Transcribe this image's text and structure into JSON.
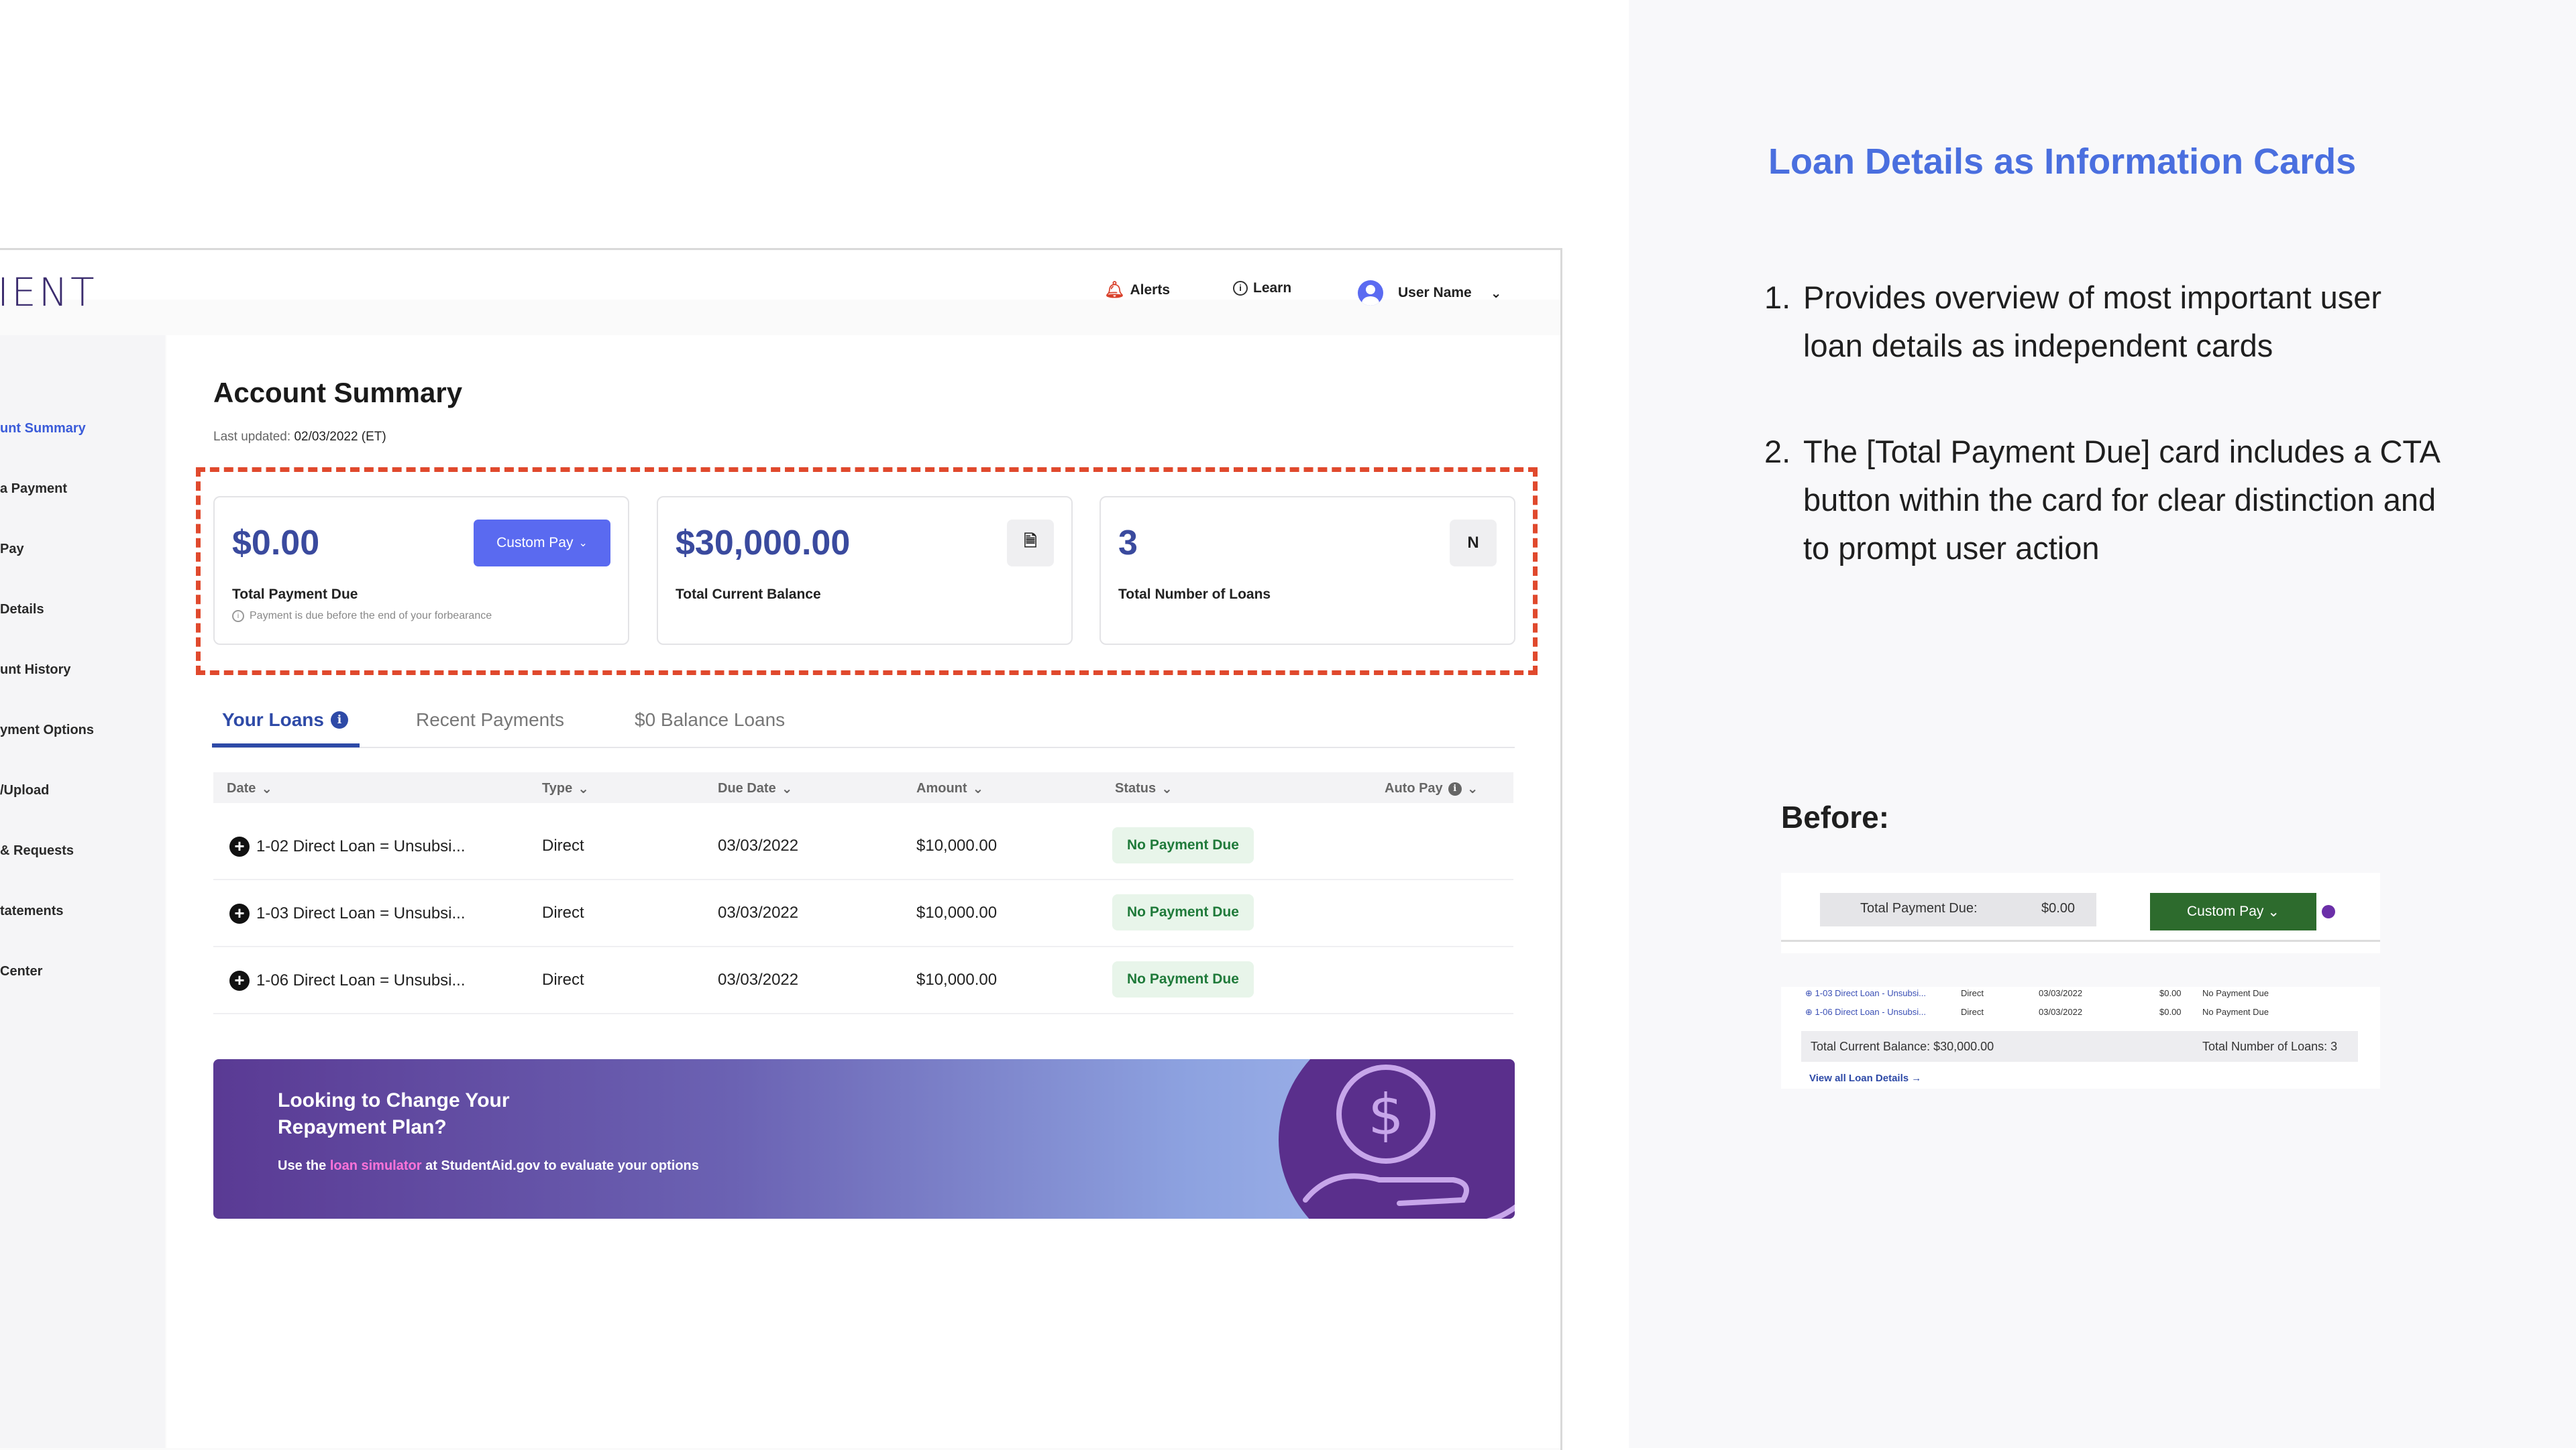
{
  "annotation": {
    "title": "Loan Details as Information Cards",
    "points": [
      {
        "num": "1.",
        "text": "Provides overview of most important user loan details as independent cards"
      },
      {
        "num": "2.",
        "text": "The [Total Payment Due] card includes a CTA button within the card for clear distinction and to prompt user action"
      }
    ],
    "before_label": "Before:",
    "before": {
      "total_payment_label": "Total Payment Due:",
      "total_payment_value": "$0.00",
      "custom_pay": "Custom Pay",
      "rows": [
        {
          "loan": "1-03 Direct Loan - Unsubsi...",
          "type": "Direct",
          "date": "03/03/2022",
          "amount": "$0.00",
          "status": "No Payment Due"
        },
        {
          "loan": "1-06 Direct Loan - Unsubsi...",
          "type": "Direct",
          "date": "03/03/2022",
          "amount": "$0.00",
          "status": "No Payment Due"
        }
      ],
      "total_balance": "Total Current Balance:  $30,000.00",
      "total_loans": "Total Number of Loans:  3",
      "view_all": "View all Loan Details →"
    }
  },
  "app": {
    "logo": "IENT",
    "header": {
      "alerts": "Alerts",
      "learn": "Learn",
      "user": "User Name"
    },
    "sidebar": [
      "unt Summary",
      "a Payment",
      "Pay",
      "Details",
      "unt History",
      "yment Options",
      "/Upload",
      "& Requests",
      "tatements",
      "Center"
    ],
    "page_title": "Account Summary",
    "last_updated_label": "Last updated:",
    "last_updated_value": "02/03/2022 (ET)",
    "cards": {
      "payment": {
        "value": "$0.00",
        "label": "Total Payment Due",
        "button": "Custom Pay",
        "note": "Payment is due before the end of your forbearance"
      },
      "balance": {
        "value": "$30,000.00",
        "label": "Total Current Balance",
        "icon": "🗎"
      },
      "loans": {
        "value": "3",
        "label": "Total Number of Loans",
        "icon": "N"
      }
    },
    "tabs": [
      "Your Loans",
      "Recent Payments",
      "$0 Balance Loans"
    ],
    "table": {
      "headers": [
        "Date",
        "Type",
        "Due Date",
        "Amount",
        "Status",
        "Auto Pay"
      ],
      "rows": [
        {
          "loan": "1-02 Direct Loan = Unsubsi...",
          "type": "Direct",
          "due": "03/03/2022",
          "amount": "$10,000.00",
          "status": "No Payment Due"
        },
        {
          "loan": "1-03 Direct Loan = Unsubsi...",
          "type": "Direct",
          "due": "03/03/2022",
          "amount": "$10,000.00",
          "status": "No Payment Due"
        },
        {
          "loan": "1-06 Direct Loan = Unsubsi...",
          "type": "Direct",
          "due": "03/03/2022",
          "amount": "$10,000.00",
          "status": "No Payment Due"
        }
      ]
    },
    "banner": {
      "title": "Looking to Change Your Repayment Plan?",
      "text_before": "Use the ",
      "link": "loan simulator",
      "text_after": " at StudentAid.gov to evaluate your options"
    }
  },
  "colors": {
    "accent": "#4a6fdf",
    "brand_dark": "#3a4a9e",
    "button": "#5a6af0",
    "highlight": "#e0492d",
    "status_green": "#1f7a3a"
  }
}
